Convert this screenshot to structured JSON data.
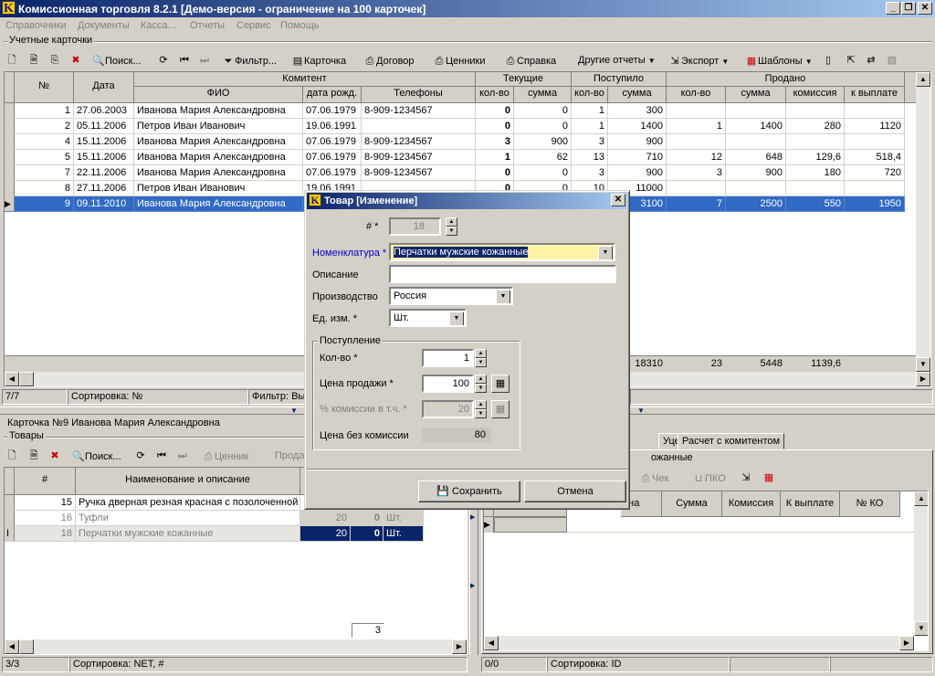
{
  "app": {
    "title": "Комиссионная торговля 8.2.1  [Демо-версия - ограничение на 100 карточек]",
    "logo": "K"
  },
  "window_buttons": {
    "minimize": "_",
    "restore": "❐",
    "close": "✕"
  },
  "menu": [
    "Справочники",
    "Документы",
    "Касса...",
    "Отчеты",
    "Сервис",
    "Помощь"
  ],
  "cards": {
    "group_title": "Учетные карточки",
    "toolbar": {
      "search": "Поиск...",
      "filter": "Фильтр...",
      "card": "Карточка",
      "contract": "Договор",
      "price_tags": "Ценники",
      "reference": "Справка",
      "other_reports": "Другие отчеты",
      "export": "Экспорт",
      "templates": "Шаблоны"
    },
    "headers": {
      "num": "№",
      "date": "Дата",
      "komitent": "Комитент",
      "fio": "ФИО",
      "birth": "дата рожд.",
      "phones": "Телефоны",
      "current": "Текущие",
      "cur_qty": "кол-во",
      "cur_sum": "сумма",
      "received": "Поступило",
      "rec_qty": "кол-во",
      "rec_sum": "сумма",
      "sold": "Продано",
      "sold_qty": "кол-во",
      "sold_sum": "сумма",
      "sold_comm": "комиссия",
      "sold_pay": "к выплате"
    },
    "rows": [
      {
        "num": "1",
        "date": "27.06.2003",
        "fio": "Иванова Мария Александровна",
        "birth": "07.06.1979",
        "phone": "8-909-1234567",
        "cq": "0",
        "cs": "0",
        "rq": "1",
        "rs": "300",
        "sq": "",
        "ss": "",
        "sc": "",
        "sp": ""
      },
      {
        "num": "2",
        "date": "05.11.2006",
        "fio": "Петров Иван Иванович",
        "birth": "19.06.1991",
        "phone": "",
        "cq": "0",
        "cs": "0",
        "rq": "1",
        "rs": "1400",
        "sq": "1",
        "ss": "1400",
        "sc": "280",
        "sp": "1120"
      },
      {
        "num": "4",
        "date": "15.11.2006",
        "fio": "Иванова Мария Александровна",
        "birth": "07.06.1979",
        "phone": "8-909-1234567",
        "cq": "3",
        "cs": "900",
        "rq": "3",
        "rs": "900",
        "sq": "",
        "ss": "",
        "sc": "",
        "sp": ""
      },
      {
        "num": "5",
        "date": "15.11.2006",
        "fio": "Иванова Мария Александровна",
        "birth": "07.06.1979",
        "phone": "8-909-1234567",
        "cq": "1",
        "cs": "62",
        "rq": "13",
        "rs": "710",
        "sq": "12",
        "ss": "648",
        "sc": "129,6",
        "sp": "518,4"
      },
      {
        "num": "7",
        "date": "22.11.2006",
        "fio": "Иванова Мария Александровна",
        "birth": "07.06.1979",
        "phone": "8-909-1234567",
        "cq": "0",
        "cs": "0",
        "rq": "3",
        "rs": "900",
        "sq": "3",
        "ss": "900",
        "sc": "180",
        "sp": "720"
      },
      {
        "num": "8",
        "date": "27.11.2006",
        "fio": "Петров Иван Иванович",
        "birth": "19.06.1991",
        "phone": "",
        "cq": "0",
        "cs": "0",
        "rq": "10",
        "rs": "11000",
        "sq": "",
        "ss": "",
        "sc": "",
        "sp": ""
      },
      {
        "num": "9",
        "date": "09.11.2010",
        "fio": "Иванова Мария Александровна",
        "birth": "",
        "phone": "",
        "cq": "",
        "cs": "",
        "rq": "",
        "rs": "3100",
        "sq": "7",
        "ss": "2500",
        "sc": "550",
        "sp": "1950"
      }
    ],
    "totals": {
      "rs": "18310",
      "sq": "23",
      "ss": "5448",
      "sc": "1139,6"
    },
    "status": {
      "count": "7/7",
      "sort": "Сортировка: №",
      "filter": "Фильтр: Вы"
    }
  },
  "card_detail": {
    "title": "Карточка №9 Иванова Мария Александровна",
    "goods_group": "Товары",
    "toolbar": {
      "search": "Поиск...",
      "price_tag": "Ценник",
      "sale": "Прода"
    },
    "headers": {
      "num": "#",
      "name": "Наименование и описание"
    },
    "rows": [
      {
        "num": "15",
        "name": "Ручка дверная резная красная с позолоченной",
        "a": "",
        "b": "",
        "u": ""
      },
      {
        "num": "16",
        "name": "Туфли",
        "a": "20",
        "b": "0",
        "u": "Шт."
      },
      {
        "num": "18",
        "name": "Перчатки мужские кожанные",
        "a": "20",
        "b": "0",
        "u": "Шт."
      }
    ],
    "footer_value": "3",
    "status": {
      "count": "3/3",
      "sort": "Сортировка: NET, #"
    },
    "tabs": {
      "markdown": "Уценка",
      "settlement": "Расчет с комитентом"
    },
    "right_group": "ожанные",
    "right_toolbar": {
      "check": "Чек",
      "pko": "ПКО"
    },
    "right_headers": {
      "price": "ена",
      "sum": "Сумма",
      "comm": "Комиссия",
      "pay": "К выплате",
      "ko": "№ КО"
    },
    "right_status": {
      "count": "0/0",
      "sort": "Сортировка: ID"
    }
  },
  "dialog": {
    "title": "Товар [Изменение]",
    "labels": {
      "num": "# *",
      "nomenclature": "Номенклатура *",
      "description": "Описание",
      "production": "Производство",
      "unit": "Ед. изм. *",
      "receipt": "Поступление",
      "qty": "Кол-во *",
      "price": "Цена продажи *",
      "commission": "% комиссии в т.ч. *",
      "price_no_comm": "Цена без комиссии"
    },
    "values": {
      "num": "18",
      "nomenclature": "Перчатки мужские кожанные",
      "description": "",
      "production": "Россия",
      "unit": "Шт.",
      "qty": "1",
      "price": "100",
      "commission": "20",
      "price_no_comm": "80"
    },
    "buttons": {
      "save": "Сохранить",
      "cancel": "Отмена"
    }
  }
}
